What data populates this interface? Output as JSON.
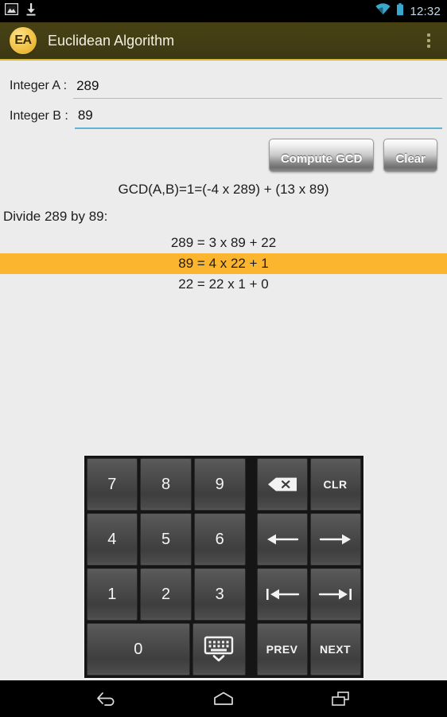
{
  "status_bar": {
    "icons_left": [
      "image-icon",
      "download-icon"
    ],
    "icons_right": [
      "wifi-icon",
      "battery-icon"
    ],
    "time": "12:32",
    "accent_color": "#33b5e5",
    "background": "#000000"
  },
  "app_bar": {
    "logo_text": "EA",
    "title": "Euclidean Algorithm",
    "overflow_icon": "overflow-menu-icon",
    "background": "#423d15",
    "accent_rule": "#d9b93a",
    "logo_color": "#f4c84e"
  },
  "form": {
    "field_a": {
      "label": "Integer A :",
      "value": "289",
      "placeholder": "",
      "focused": false,
      "underline": "#b9b9b9"
    },
    "field_b": {
      "label": "Integer B :",
      "value": "89",
      "placeholder": "",
      "focused": true,
      "underline": "#60b5d0"
    },
    "compute_label": "Compute GCD",
    "clear_label": "Clear"
  },
  "results": {
    "summary": "GCD(A,B)=1=(-4 x 289) + (13 x 89)",
    "heading": "Divide 289 by 89:",
    "highlight_color": "#fcb52e",
    "steps": [
      {
        "text": "289 = 3 x 89 + 22",
        "highlighted": false
      },
      {
        "text": "89 = 4 x 22 + 1",
        "highlighted": true
      },
      {
        "text": "22 = 22 x 1 + 0",
        "highlighted": false
      }
    ]
  },
  "keypad": {
    "rows": [
      {
        "left": [
          {
            "label": "7",
            "name": "key-7"
          },
          {
            "label": "8",
            "name": "key-8"
          },
          {
            "label": "9",
            "name": "key-9"
          }
        ],
        "right": [
          {
            "label": "",
            "name": "key-backspace",
            "icon": "backspace-icon"
          },
          {
            "label": "CLR",
            "name": "key-clear",
            "small": true
          }
        ]
      },
      {
        "left": [
          {
            "label": "4",
            "name": "key-4"
          },
          {
            "label": "5",
            "name": "key-5"
          },
          {
            "label": "6",
            "name": "key-6"
          }
        ],
        "right": [
          {
            "label": "",
            "name": "key-arrow-left",
            "icon": "arrow-left-icon"
          },
          {
            "label": "",
            "name": "key-arrow-right",
            "icon": "arrow-right-icon"
          }
        ]
      },
      {
        "left": [
          {
            "label": "1",
            "name": "key-1"
          },
          {
            "label": "2",
            "name": "key-2"
          },
          {
            "label": "3",
            "name": "key-3"
          }
        ],
        "right": [
          {
            "label": "",
            "name": "key-home",
            "icon": "arrow-to-start-icon"
          },
          {
            "label": "",
            "name": "key-end",
            "icon": "arrow-to-end-icon"
          }
        ]
      },
      {
        "left": [
          {
            "label": "0",
            "name": "key-0",
            "wide": true
          },
          {
            "label": "",
            "name": "key-hide-keyboard",
            "icon": "keyboard-hide-icon"
          }
        ],
        "right": [
          {
            "label": "PREV",
            "name": "key-prev",
            "small": true
          },
          {
            "label": "NEXT",
            "name": "key-next",
            "small": true
          }
        ]
      }
    ]
  },
  "nav_bar": {
    "buttons": [
      {
        "name": "nav-back-button",
        "icon": "back-icon"
      },
      {
        "name": "nav-home-button",
        "icon": "home-icon"
      },
      {
        "name": "nav-recents-button",
        "icon": "recents-icon"
      }
    ]
  }
}
